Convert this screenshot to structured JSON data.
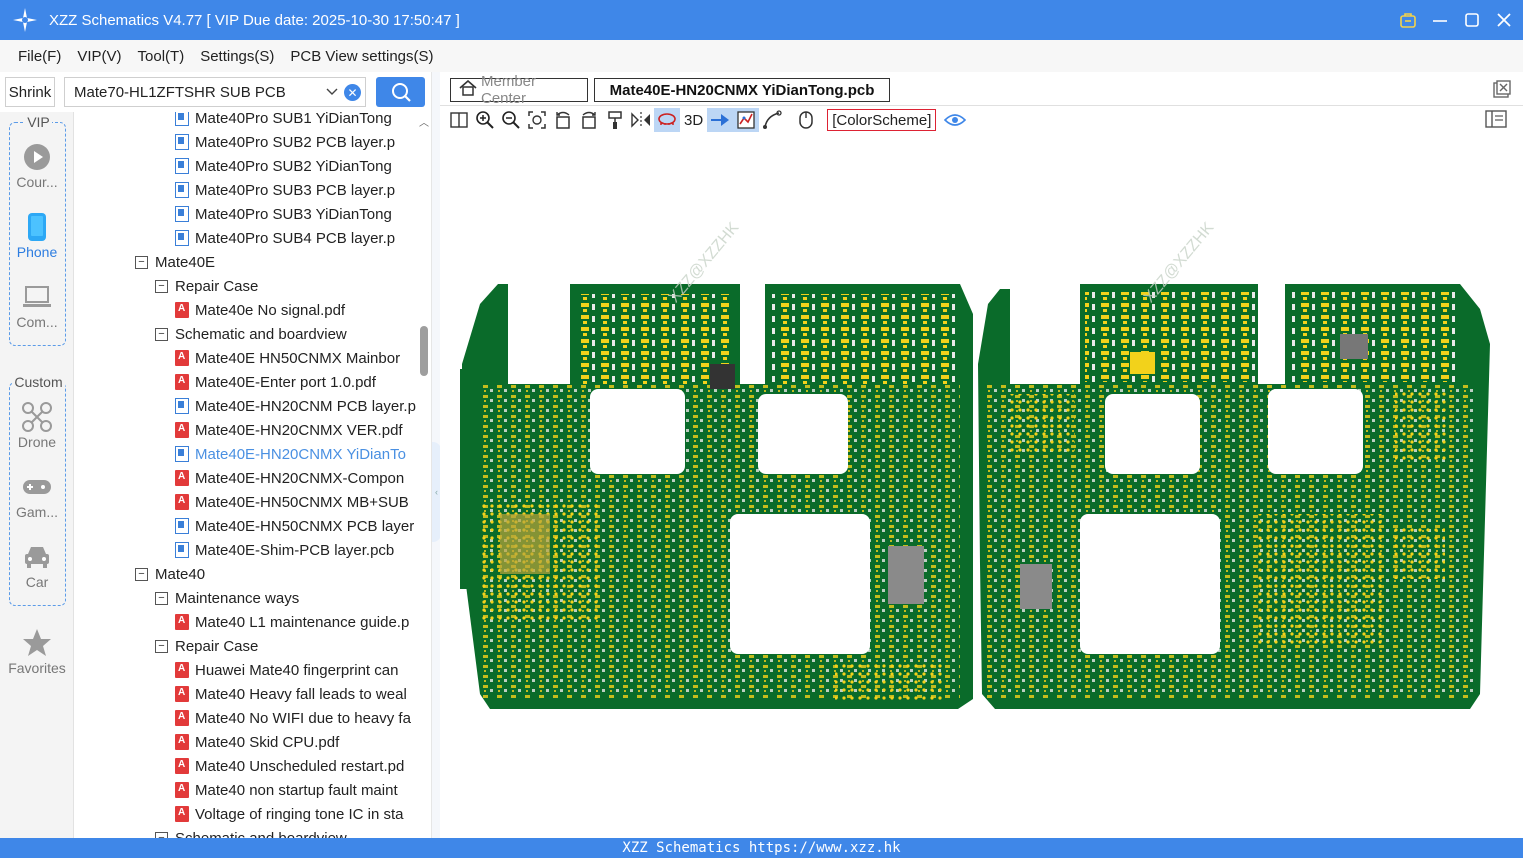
{
  "window": {
    "title": "XZZ Schematics V4.77 [ VIP Due date: 2025-10-30 17:50:47 ]"
  },
  "menu": [
    "File(F)",
    "VIP(V)",
    "Tool(T)",
    "Settings(S)",
    "PCB View settings(S)"
  ],
  "search": {
    "shrink_label": "Shrink",
    "selected_value": "Mate70-HL1ZFTSHR SUB PCB"
  },
  "rail": {
    "vip_label": "VIP",
    "custom_label": "Custom",
    "items": [
      {
        "label": "Cour...",
        "icon": "play-circle-icon"
      },
      {
        "label": "Phone",
        "icon": "phone-icon",
        "active": true
      },
      {
        "label": "Com...",
        "icon": "laptop-icon"
      },
      {
        "label": "Drone",
        "icon": "drone-icon"
      },
      {
        "label": "Gam...",
        "icon": "gamepad-icon"
      },
      {
        "label": "Car",
        "icon": "car-icon"
      },
      {
        "label": "Favorites",
        "icon": "star-icon"
      }
    ]
  },
  "tree": [
    {
      "level": 3,
      "type": "pcb",
      "text": "Mate40Pro SUB1 YiDianTong"
    },
    {
      "level": 3,
      "type": "pcb",
      "text": "Mate40Pro SUB2 PCB layer.p"
    },
    {
      "level": 3,
      "type": "pcb",
      "text": "Mate40Pro SUB2 YiDianTong"
    },
    {
      "level": 3,
      "type": "pcb",
      "text": "Mate40Pro SUB3 PCB layer.p"
    },
    {
      "level": 3,
      "type": "pcb",
      "text": "Mate40Pro SUB3 YiDianTong"
    },
    {
      "level": 3,
      "type": "pcb",
      "text": "Mate40Pro SUB4 PCB layer.p"
    },
    {
      "level": 1,
      "type": "folder",
      "text": "Mate40E"
    },
    {
      "level": 2,
      "type": "folder",
      "text": "Repair Case"
    },
    {
      "level": 3,
      "type": "pdf",
      "text": "Mate40e No signal.pdf"
    },
    {
      "level": 2,
      "type": "folder",
      "text": "Schematic and boardview"
    },
    {
      "level": 3,
      "type": "pdf",
      "text": "Mate40E HN50CNMX Mainbor"
    },
    {
      "level": 3,
      "type": "pdf",
      "text": "Mate40E-Enter port 1.0.pdf"
    },
    {
      "level": 3,
      "type": "pcb",
      "text": "Mate40E-HN20CNM PCB layer.p"
    },
    {
      "level": 3,
      "type": "pdf",
      "text": "Mate40E-HN20CNMX VER.pdf"
    },
    {
      "level": 3,
      "type": "pcb",
      "text": "Mate40E-HN20CNMX YiDianTo",
      "selected": true
    },
    {
      "level": 3,
      "type": "pdf",
      "text": "Mate40E-HN20CNMX-Compon"
    },
    {
      "level": 3,
      "type": "pdf",
      "text": "Mate40E-HN50CNMX MB+SUB"
    },
    {
      "level": 3,
      "type": "pcb",
      "text": "Mate40E-HN50CNMX PCB layer"
    },
    {
      "level": 3,
      "type": "pcb",
      "text": "Mate40E-Shim-PCB layer.pcb"
    },
    {
      "level": 1,
      "type": "folder",
      "text": "Mate40"
    },
    {
      "level": 2,
      "type": "folder",
      "text": "Maintenance ways"
    },
    {
      "level": 3,
      "type": "pdf",
      "text": "Mate40 L1 maintenance guide.p"
    },
    {
      "level": 2,
      "type": "folder",
      "text": "Repair Case"
    },
    {
      "level": 3,
      "type": "pdf",
      "text": "Huawei Mate40 fingerprint can"
    },
    {
      "level": 3,
      "type": "pdf",
      "text": "Mate40 Heavy fall leads to weal"
    },
    {
      "level": 3,
      "type": "pdf",
      "text": "Mate40 No WIFI due to heavy fa"
    },
    {
      "level": 3,
      "type": "pdf",
      "text": "Mate40 Skid CPU.pdf"
    },
    {
      "level": 3,
      "type": "pdf",
      "text": "Mate40 Unscheduled restart.pd"
    },
    {
      "level": 3,
      "type": "pdf",
      "text": "Mate40 non startup fault maint"
    },
    {
      "level": 3,
      "type": "pdf",
      "text": "Voltage of ringing tone IC in sta"
    },
    {
      "level": 2,
      "type": "folder",
      "text": "Schematic and boardview"
    }
  ],
  "tabs": {
    "member": "Member Center",
    "active": "Mate40E-HN20CNMX YiDianTong.pcb"
  },
  "toolbar": {
    "label_3d": "3D",
    "color_scheme": "[ColorScheme]"
  },
  "watermark": "XZZ@XZZHK",
  "status": "XZZ Schematics https://www.xzz.hk",
  "colors": {
    "accent": "#3f87e8",
    "board": "#0a6b2a",
    "pad": "#f2d21b"
  }
}
